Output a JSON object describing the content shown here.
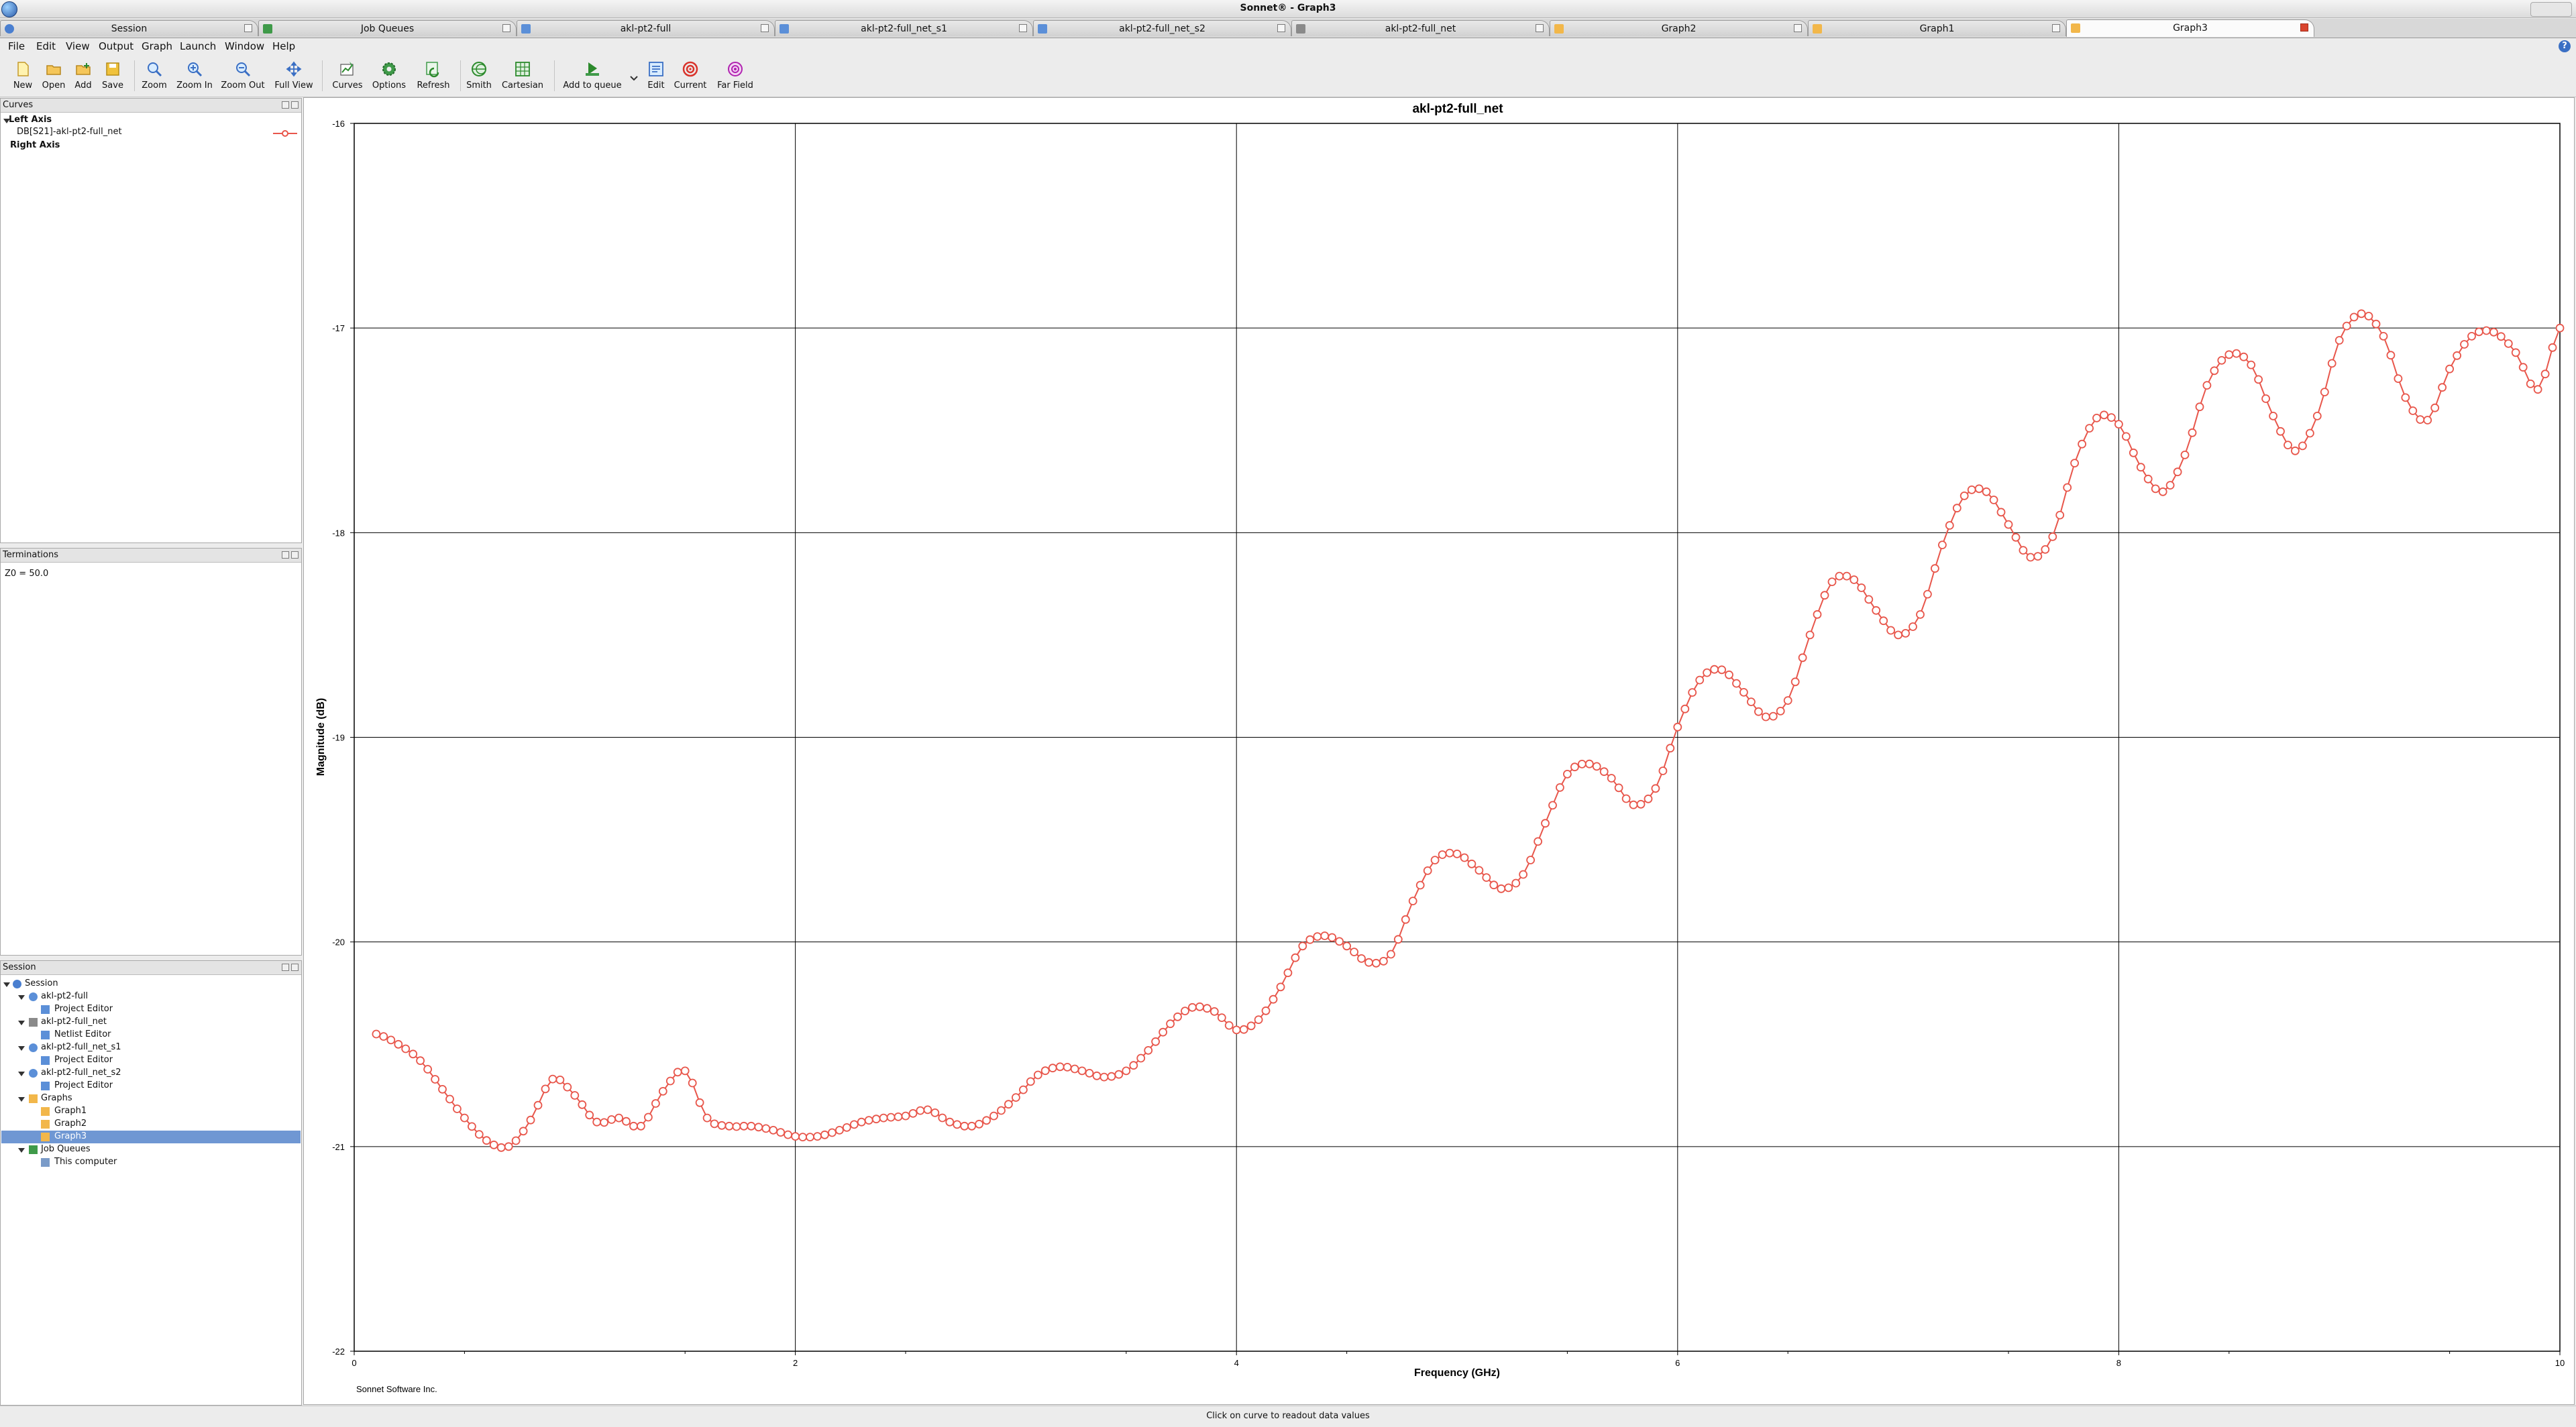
{
  "window": {
    "title": "Sonnet® - Graph3"
  },
  "tabs": [
    {
      "label": "Session",
      "icon": "session-icon"
    },
    {
      "label": "Job Queues",
      "icon": "job-queue-icon"
    },
    {
      "label": "akl-pt2-full",
      "icon": "project-editor-icon"
    },
    {
      "label": "akl-pt2-full_net_s1",
      "icon": "project-editor-icon"
    },
    {
      "label": "akl-pt2-full_net_s2",
      "icon": "project-editor-icon"
    },
    {
      "label": "akl-pt2-full_net",
      "icon": "netlist-editor-icon"
    },
    {
      "label": "Graph2",
      "icon": "graph-icon"
    },
    {
      "label": "Graph1",
      "icon": "graph-icon"
    },
    {
      "label": "Graph3",
      "icon": "graph-icon"
    }
  ],
  "active_tab": "Graph3",
  "menu": [
    "File",
    "Edit",
    "View",
    "Output",
    "Graph",
    "Launch",
    "Window",
    "Help"
  ],
  "toolbar": {
    "new": "New",
    "open": "Open",
    "add": "Add",
    "save": "Save",
    "zoom": "Zoom",
    "zoom_in": "Zoom In",
    "zoom_out": "Zoom Out",
    "full_view": "Full View",
    "curves": "Curves",
    "options": "Options",
    "refresh": "Refresh",
    "smith": "Smith",
    "cartesian": "Cartesian",
    "add_to_queue": "Add to queue",
    "edit": "Edit",
    "current": "Current",
    "far_field": "Far Field"
  },
  "curves_panel": {
    "title": "Curves",
    "left_axis": "Left Axis",
    "curve_name": "DB[S21]-akl-pt2-full_net",
    "right_axis": "Right Axis"
  },
  "terminations_panel": {
    "title": "Terminations",
    "text": "Z0 = 50.0"
  },
  "session_panel": {
    "title": "Session",
    "root": "Session",
    "project1": "akl-pt2-full",
    "project1_child": "Project Editor",
    "project2": "akl-pt2-full_net",
    "project2_child": "Netlist Editor",
    "project3": "akl-pt2-full_net_s1",
    "project3_child": "Project Editor",
    "project4": "akl-pt2-full_net_s2",
    "project4_child": "Project Editor",
    "graphs": "Graphs",
    "graph1": "Graph1",
    "graph2": "Graph2",
    "graph3": "Graph3",
    "job_queues": "Job Queues",
    "this_computer": "This computer"
  },
  "graph_footer": "Sonnet Software Inc.",
  "status": "Click on curve to readout data values",
  "colors": {
    "curve": "#e8564b",
    "selection": "#6f97d3",
    "accent": "#3a6fc4"
  },
  "chart_data": {
    "type": "line",
    "title": "akl-pt2-full_net",
    "xlabel": "Frequency (GHz)",
    "ylabel": "Magnitude (dB)",
    "xlim": [
      0,
      10
    ],
    "ylim": [
      -22,
      -16
    ],
    "xticks": [
      "0",
      "2",
      "4",
      "6",
      "8",
      "10"
    ],
    "yticks": [
      "-16",
      "-17",
      "-18",
      "-19",
      "-20",
      "-21",
      "-22"
    ],
    "grid": true,
    "marker": "circle",
    "x": [
      0.1,
      0.2,
      0.3,
      0.4,
      0.5,
      0.6,
      0.7,
      0.8,
      0.9,
      1.0,
      1.1,
      1.2,
      1.3,
      1.4,
      1.5,
      1.6,
      1.7,
      1.8,
      1.9,
      2.0,
      2.1,
      2.2,
      2.3,
      2.4,
      2.5,
      2.6,
      2.7,
      2.8,
      2.9,
      3.0,
      3.1,
      3.2,
      3.3,
      3.4,
      3.5,
      3.6,
      3.7,
      3.8,
      3.9,
      4.0,
      4.1,
      4.2,
      4.3,
      4.4,
      4.5,
      4.6,
      4.7,
      4.8,
      4.9,
      5.0,
      5.1,
      5.2,
      5.3,
      5.4,
      5.5,
      5.6,
      5.7,
      5.8,
      5.9,
      6.0,
      6.1,
      6.2,
      6.3,
      6.4,
      6.5,
      6.6,
      6.7,
      6.8,
      6.9,
      7.0,
      7.1,
      7.2,
      7.3,
      7.4,
      7.5,
      7.6,
      7.7,
      7.8,
      7.9,
      8.0,
      8.1,
      8.2,
      8.3,
      8.4,
      8.5,
      8.6,
      8.7,
      8.8,
      8.9,
      9.0,
      9.1,
      9.2,
      9.3,
      9.4,
      9.5,
      9.6,
      9.7,
      9.8,
      9.9,
      10.0
    ],
    "y": [
      -20.45,
      -20.5,
      -20.58,
      -20.72,
      -20.86,
      -20.97,
      -21.0,
      -20.87,
      -20.67,
      -20.75,
      -20.88,
      -20.86,
      -20.9,
      -20.73,
      -20.63,
      -20.86,
      -20.9,
      -20.9,
      -20.92,
      -20.95,
      -20.95,
      -20.92,
      -20.88,
      -20.86,
      -20.85,
      -20.82,
      -20.88,
      -20.9,
      -20.85,
      -20.76,
      -20.65,
      -20.61,
      -20.63,
      -20.66,
      -20.63,
      -20.53,
      -20.4,
      -20.32,
      -20.34,
      -20.43,
      -20.38,
      -20.22,
      -20.02,
      -19.97,
      -20.02,
      -20.1,
      -20.06,
      -19.8,
      -19.6,
      -19.57,
      -19.65,
      -19.74,
      -19.67,
      -19.42,
      -19.18,
      -19.13,
      -19.2,
      -19.33,
      -19.25,
      -18.95,
      -18.72,
      -18.67,
      -18.78,
      -18.9,
      -18.82,
      -18.5,
      -18.24,
      -18.23,
      -18.38,
      -18.5,
      -18.4,
      -18.06,
      -17.82,
      -17.8,
      -17.96,
      -18.12,
      -18.02,
      -17.66,
      -17.44,
      -17.47,
      -17.68,
      -17.8,
      -17.62,
      -17.28,
      -17.13,
      -17.18,
      -17.43,
      -17.6,
      -17.43,
      -17.06,
      -16.93,
      -17.04,
      -17.34,
      -17.45,
      -17.2,
      -17.04,
      -17.02,
      -17.12,
      -17.3,
      -17.0
    ],
    "series_color": "#e8564b"
  }
}
